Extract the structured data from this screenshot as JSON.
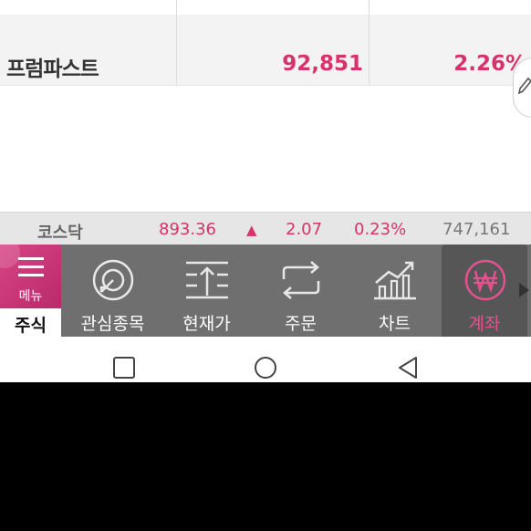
{
  "stock_row": {
    "name": "프럼파스트",
    "price": "92,851",
    "rate": "2.26%"
  },
  "ticker": {
    "name": "코스닥",
    "value": "893.36",
    "arrow": "▲",
    "change": "2.07",
    "rate": "0.23%",
    "volume": "747,161"
  },
  "menu": {
    "label": "메뉴",
    "stock_tab": "주식"
  },
  "nav": [
    {
      "label": "관심종목",
      "icon": "watchlist-icon"
    },
    {
      "label": "현재가",
      "icon": "current-price-icon"
    },
    {
      "label": "주문",
      "icon": "order-icon"
    },
    {
      "label": "차트",
      "icon": "chart-icon"
    },
    {
      "label": "계좌",
      "icon": "won-icon"
    }
  ],
  "colors": {
    "up": "#d6336c",
    "accent": "#d94486",
    "nav_bg": "#6f6f6f",
    "active_label": "#e5508e"
  }
}
